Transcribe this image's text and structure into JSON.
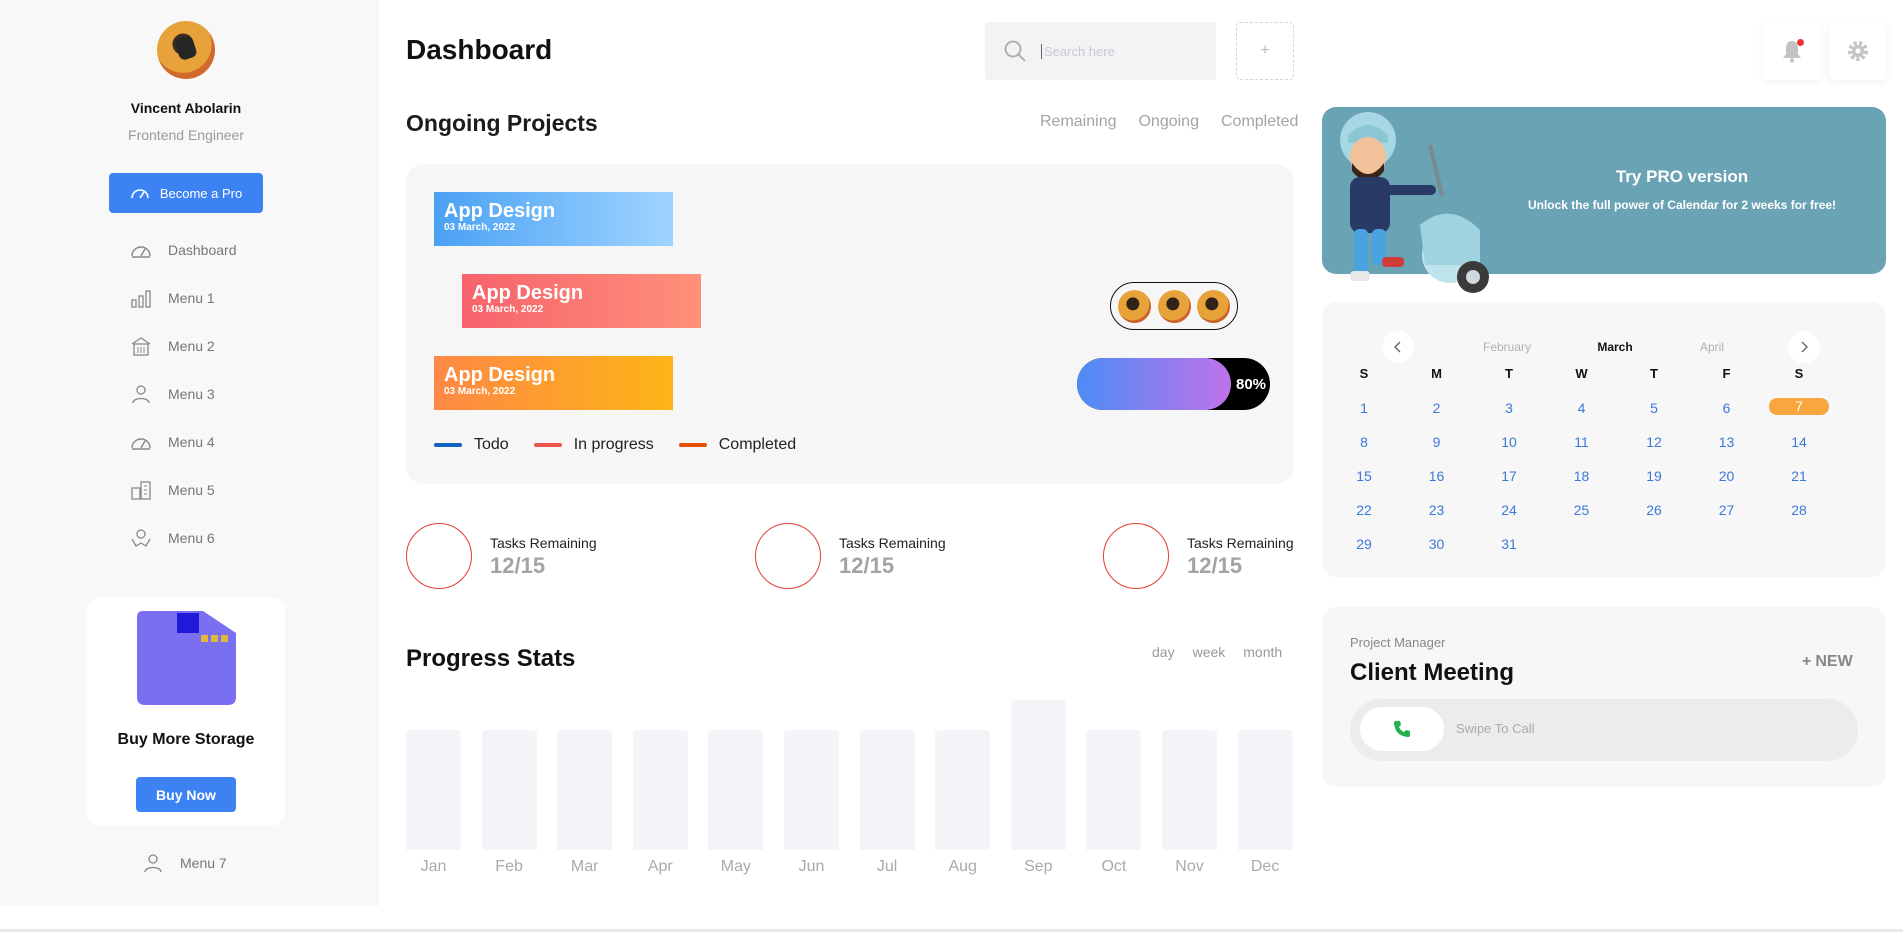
{
  "user": {
    "name": "Vincent Abolarin",
    "role": "Frontend Engineer"
  },
  "sidebar": {
    "pro_label": "Become a Pro",
    "items": [
      {
        "label": "Dashboard",
        "icon": "gauge-icon"
      },
      {
        "label": "Menu 1",
        "icon": "chart-icon"
      },
      {
        "label": "Menu 2",
        "icon": "building-icon"
      },
      {
        "label": "Menu 3",
        "icon": "user-icon"
      },
      {
        "label": "Menu 4",
        "icon": "gauge-icon"
      },
      {
        "label": "Menu 5",
        "icon": "buildings-icon"
      },
      {
        "label": "Menu 6",
        "icon": "hands-icon"
      }
    ],
    "storage": {
      "title": "Buy More Storage",
      "button": "Buy Now"
    },
    "bottom_item": {
      "label": "Menu 7",
      "icon": "user-icon"
    }
  },
  "header": {
    "title": "Dashboard",
    "search_placeholder": "Search here",
    "add_label": "+"
  },
  "projects": {
    "title": "Ongoing Projects",
    "filters": [
      "Remaining",
      "Ongoing",
      "Completed"
    ],
    "bars": [
      {
        "title": "App Design",
        "date": "03 March, 2022"
      },
      {
        "title": "App Design",
        "date": "03 March, 2022"
      },
      {
        "title": "App Design",
        "date": "03 March, 2022"
      }
    ],
    "progress": {
      "value": 0.8,
      "label": "80%"
    },
    "legend": [
      {
        "label": "Todo",
        "color": "#1565c0"
      },
      {
        "label": "In progress",
        "color": "#ef5350"
      },
      {
        "label": "Completed",
        "color": "#e65100"
      }
    ]
  },
  "tasks": [
    {
      "label": "Tasks Remaining",
      "value": "12/15"
    },
    {
      "label": "Tasks Remaining",
      "value": "12/15"
    },
    {
      "label": "Tasks Remaining",
      "value": "12/15"
    }
  ],
  "stats": {
    "title": "Progress Stats",
    "ranges": [
      "day",
      "week",
      "month"
    ],
    "months": [
      "Jan",
      "Feb",
      "Mar",
      "Apr",
      "May",
      "Jun",
      "Jul",
      "Aug",
      "Sep",
      "Oct",
      "Nov",
      "Dec"
    ],
    "values": [
      120,
      120,
      120,
      120,
      120,
      120,
      120,
      120,
      150,
      120,
      120,
      120
    ]
  },
  "promo": {
    "title": "Try PRO version",
    "subtitle": "Unlock the full power of Calendar for 2 weeks for free!"
  },
  "calendar": {
    "prev_month": "February",
    "current_month": "March",
    "next_month": "April",
    "weekdays": [
      "S",
      "M",
      "T",
      "W",
      "T",
      "F",
      "S"
    ],
    "days": [
      "1",
      "2",
      "3",
      "4",
      "5",
      "6",
      "7",
      "8",
      "9",
      "10",
      "11",
      "12",
      "13",
      "14",
      "15",
      "16",
      "17",
      "18",
      "19",
      "20",
      "21",
      "22",
      "23",
      "24",
      "25",
      "26",
      "27",
      "28",
      "29",
      "30",
      "31"
    ],
    "today": "7",
    "accent": "#f7a73d"
  },
  "meeting": {
    "role": "Project Manager",
    "title": "Client Meeting",
    "new_label": "NEW",
    "swipe_label": "Swipe To Call"
  },
  "colors": {
    "primary": "#3d82f3",
    "promo": "#6aa3b4",
    "ring": "#e53935"
  }
}
